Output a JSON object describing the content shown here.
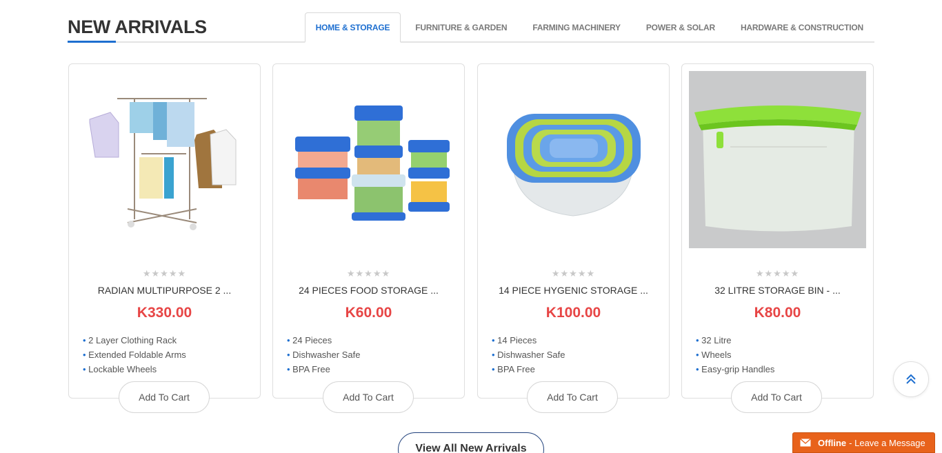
{
  "header": {
    "title": "NEW ARRIVALS"
  },
  "tabs": [
    {
      "label": "HOME & STORAGE",
      "active": true
    },
    {
      "label": "FURNITURE & GARDEN",
      "active": false
    },
    {
      "label": "FARMING MACHINERY",
      "active": false
    },
    {
      "label": "POWER & SOLAR",
      "active": false
    },
    {
      "label": "HARDWARE & CONSTRUCTION",
      "active": false
    }
  ],
  "products": [
    {
      "name": "RADIAN MULTIPURPOSE 2 ...",
      "price": "K330.00",
      "rating": "★★★★★",
      "features": [
        "2 Layer Clothing Rack",
        "Extended Foldable Arms",
        "Lockable Wheels"
      ],
      "cart_label": "Add To Cart",
      "image": "clothing-rack-image"
    },
    {
      "name": "24 PIECES FOOD STORAGE ...",
      "price": "K60.00",
      "rating": "★★★★★",
      "features": [
        "24 Pieces",
        "Dishwasher Safe",
        "BPA Free"
      ],
      "cart_label": "Add To Cart",
      "image": "food-containers-image"
    },
    {
      "name": "14 PIECE HYGENIC STORAGE ...",
      "price": "K100.00",
      "rating": "★★★★★",
      "features": [
        "14 Pieces",
        "Dishwasher Safe",
        "BPA Free"
      ],
      "cart_label": "Add To Cart",
      "image": "nested-containers-image"
    },
    {
      "name": "32 LITRE STORAGE BIN - ...",
      "price": "K80.00",
      "rating": "★★★★★",
      "features": [
        "32 Litre",
        "Wheels",
        "Easy-grip Handles"
      ],
      "cart_label": "Add To Cart",
      "image": "storage-bin-image"
    }
  ],
  "view_all_label": "View All New Arrivals",
  "chat": {
    "status": "Offline",
    "message": "- Leave a Message"
  },
  "colors": {
    "accent": "#1e6fd0",
    "price": "#e74545",
    "chat": "#e8621b"
  }
}
